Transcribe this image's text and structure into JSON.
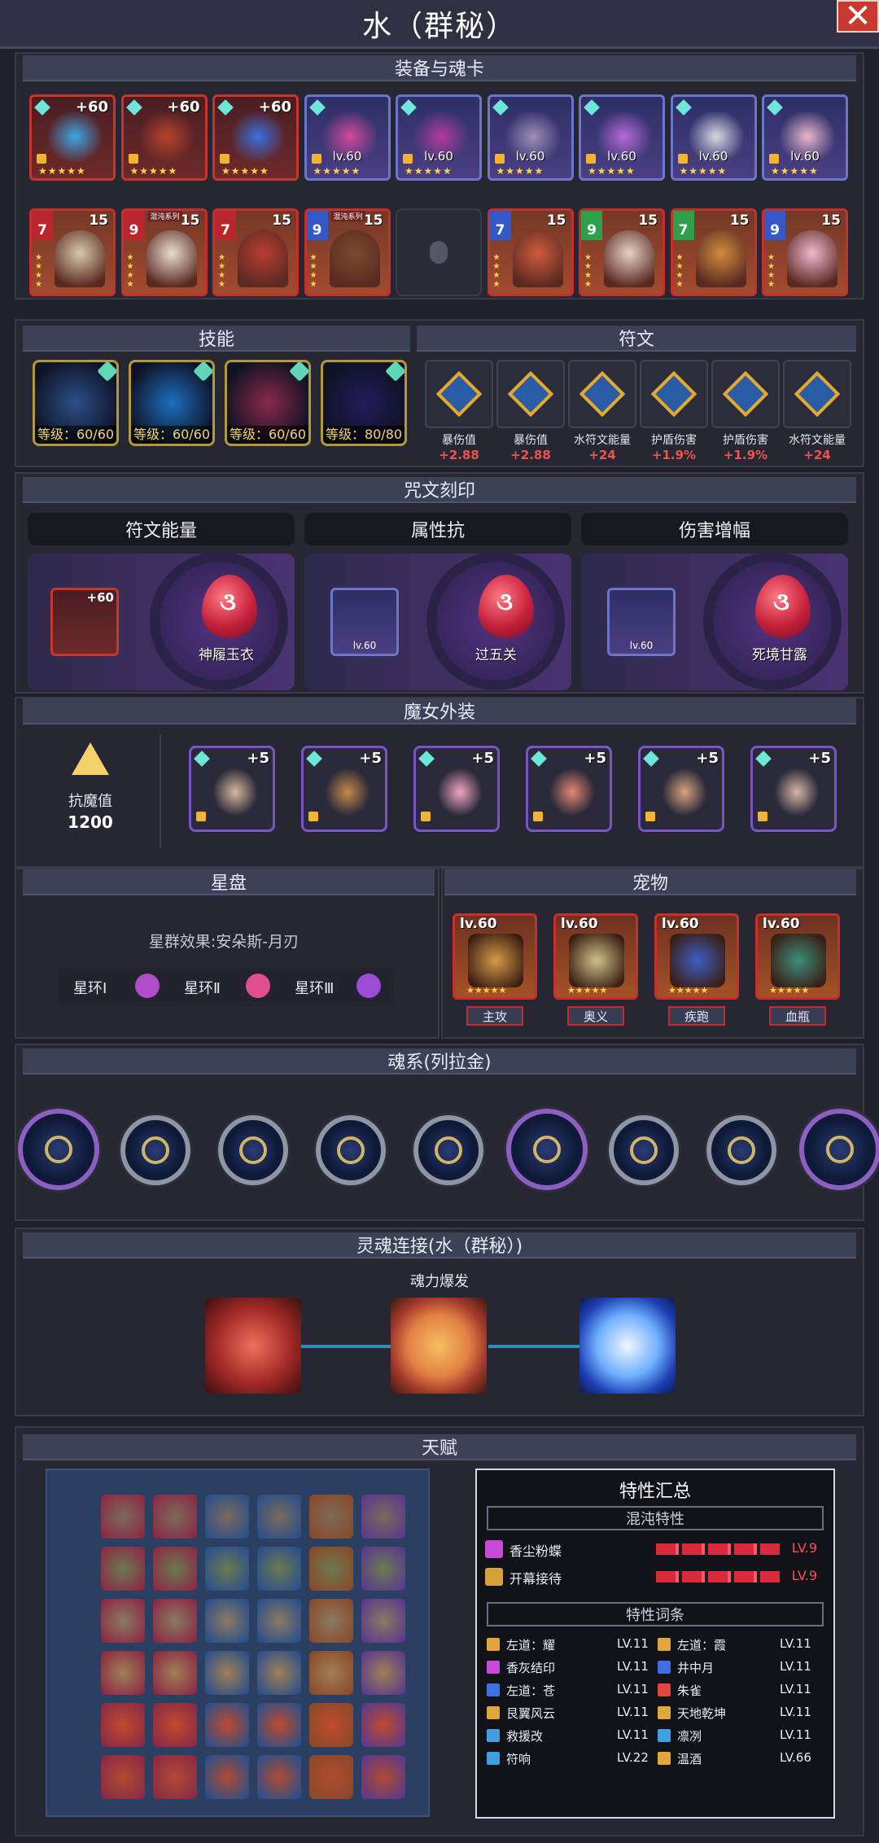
{
  "title": "水（群秘）",
  "sections": {
    "equip": "装备与魂卡",
    "skills": "技能",
    "runes": "符文",
    "engrave": "咒文刻印",
    "costume": "魔女外装",
    "star": "星盘",
    "pet": "宠物",
    "soul": "魂系(列拉金)",
    "link": "灵魂连接(水（群秘）)",
    "talent": "天赋"
  },
  "equipment": [
    {
      "plus": "+60",
      "lv": "",
      "type": "red",
      "color": "#3da7e6"
    },
    {
      "plus": "+60",
      "lv": "",
      "type": "red",
      "color": "#b9442e"
    },
    {
      "plus": "+60",
      "lv": "",
      "type": "red",
      "color": "#3b6fe0"
    },
    {
      "plus": "",
      "lv": "lv.60",
      "type": "blue",
      "color": "#d5489d"
    },
    {
      "plus": "",
      "lv": "lv.60",
      "type": "blue",
      "color": "#b23b9d"
    },
    {
      "plus": "",
      "lv": "lv.60",
      "type": "blue",
      "color": "#9e8fb8"
    },
    {
      "plus": "",
      "lv": "lv.60",
      "type": "blue",
      "color": "#b66bd6"
    },
    {
      "plus": "",
      "lv": "lv.60",
      "type": "blue",
      "color": "#d9d9e3"
    },
    {
      "plus": "",
      "lv": "lv.60",
      "type": "blue",
      "color": "#e7b8c8"
    }
  ],
  "soulcards": [
    {
      "rank": "7",
      "num": "15",
      "tag": "",
      "rankColor": "red",
      "face": "#d8c9a9"
    },
    {
      "rank": "9",
      "num": "15",
      "tag": "混沌系列",
      "rankColor": "red",
      "face": "#e9ddd3"
    },
    {
      "rank": "7",
      "num": "15",
      "tag": "",
      "rankColor": "red",
      "face": "#b83d33"
    },
    {
      "rank": "9",
      "num": "15",
      "tag": "混沌系列",
      "rankColor": "blue",
      "face": "#7b4a2c"
    },
    {
      "empty": true
    },
    {
      "rank": "7",
      "num": "15",
      "tag": "",
      "rankColor": "blue",
      "face": "#cf5b3c"
    },
    {
      "rank": "9",
      "num": "15",
      "tag": "",
      "rankColor": "green",
      "face": "#e6d2c4"
    },
    {
      "rank": "7",
      "num": "15",
      "tag": "",
      "rankColor": "green",
      "face": "#d38a3a"
    },
    {
      "rank": "9",
      "num": "15",
      "tag": "",
      "rankColor": "blue",
      "face": "#f2b7d0"
    }
  ],
  "skills": [
    {
      "label": "等级：60/60",
      "color": "#2d4f8a"
    },
    {
      "label": "等级：60/60",
      "color": "#1d6fbf"
    },
    {
      "label": "等级：60/60",
      "color": "#8a2a4a"
    },
    {
      "label": "等级：80/80",
      "color": "#241c5a"
    }
  ],
  "runes": [
    {
      "name": "暴伤值",
      "value": "+2.88"
    },
    {
      "name": "暴伤值",
      "value": "+2.88"
    },
    {
      "name": "水符文能量",
      "value": "+24"
    },
    {
      "name": "护盾伤害",
      "value": "+1.9%"
    },
    {
      "name": "护盾伤害",
      "value": "+1.9%"
    },
    {
      "name": "水符文能量",
      "value": "+24"
    }
  ],
  "engravings": [
    {
      "header": "符文能量",
      "item_plus": "+60",
      "item_lv": "",
      "item_type": "red",
      "drop_name": "神履玉衣"
    },
    {
      "header": "属性抗",
      "item_plus": "",
      "item_lv": "lv.60",
      "item_type": "blue",
      "drop_name": "过五关"
    },
    {
      "header": "伤害增幅",
      "item_plus": "",
      "item_lv": "lv.60",
      "item_type": "blue",
      "drop_name": "死境甘露"
    }
  ],
  "costume": {
    "resist_label": "抗魔值",
    "resist_value": "1200",
    "items": [
      {
        "plus": "+5",
        "color": "#d9b79b"
      },
      {
        "plus": "+5",
        "color": "#c58a4c"
      },
      {
        "plus": "+5",
        "color": "#f1a6c2"
      },
      {
        "plus": "+5",
        "color": "#e3876f"
      },
      {
        "plus": "+5",
        "color": "#d8a37d"
      },
      {
        "plus": "+5",
        "color": "#d8b5a4"
      }
    ]
  },
  "star": {
    "effect": "星群效果:安朵斯-月刃",
    "rings": [
      "星环Ⅰ",
      "星环Ⅱ",
      "星环Ⅲ"
    ]
  },
  "pets": [
    {
      "lv": "lv.60",
      "label": "主攻",
      "face": "#d69a47"
    },
    {
      "lv": "lv.60",
      "label": "奥义",
      "face": "#cfc08a"
    },
    {
      "lv": "lv.60",
      "label": "疾跑",
      "face": "#3d5fc4"
    },
    {
      "lv": "lv.60",
      "label": "血瓶",
      "face": "#3a8d7a"
    }
  ],
  "soul_orbs": [
    "orb-1",
    "orb-2",
    "orb-3",
    "orb-4",
    "orb-5",
    "orb-6",
    "orb-7",
    "orb-8",
    "orb-9"
  ],
  "link": {
    "label": "魂力爆发"
  },
  "traits": {
    "title": "特性汇总",
    "chaos": "混沌特性",
    "chaos_items": [
      {
        "name": "香尘粉蝶",
        "lv": "LV.9",
        "color": "#c94ad6"
      },
      {
        "name": "开幕接待",
        "lv": "LV.9",
        "color": "#d8a23b"
      }
    ],
    "entries_title": "特性词条",
    "entries": [
      {
        "name": "左道：耀",
        "lv": "LV.11",
        "color": "#e2a73b"
      },
      {
        "name": "左道：霞",
        "lv": "LV.11",
        "color": "#e2a73b"
      },
      {
        "name": "香灰结印",
        "lv": "LV.11",
        "color": "#c94ad6"
      },
      {
        "name": "井中月",
        "lv": "LV.11",
        "color": "#3f6fe0"
      },
      {
        "name": "左道：苍",
        "lv": "LV.11",
        "color": "#3f6fe0"
      },
      {
        "name": "朱雀",
        "lv": "LV.11",
        "color": "#e0463b"
      },
      {
        "name": "艮翼风云",
        "lv": "LV.11",
        "color": "#e2a73b"
      },
      {
        "name": "天地乾坤",
        "lv": "LV.11",
        "color": "#e2a73b"
      },
      {
        "name": "救援改",
        "lv": "LV.11",
        "color": "#3f9fe0"
      },
      {
        "name": "凛冽",
        "lv": "LV.11",
        "color": "#3f9fe0"
      },
      {
        "name": "符响",
        "lv": "LV.22",
        "color": "#3f9fe0"
      },
      {
        "name": "温酒",
        "lv": "LV.66",
        "color": "#e2a73b"
      }
    ]
  }
}
